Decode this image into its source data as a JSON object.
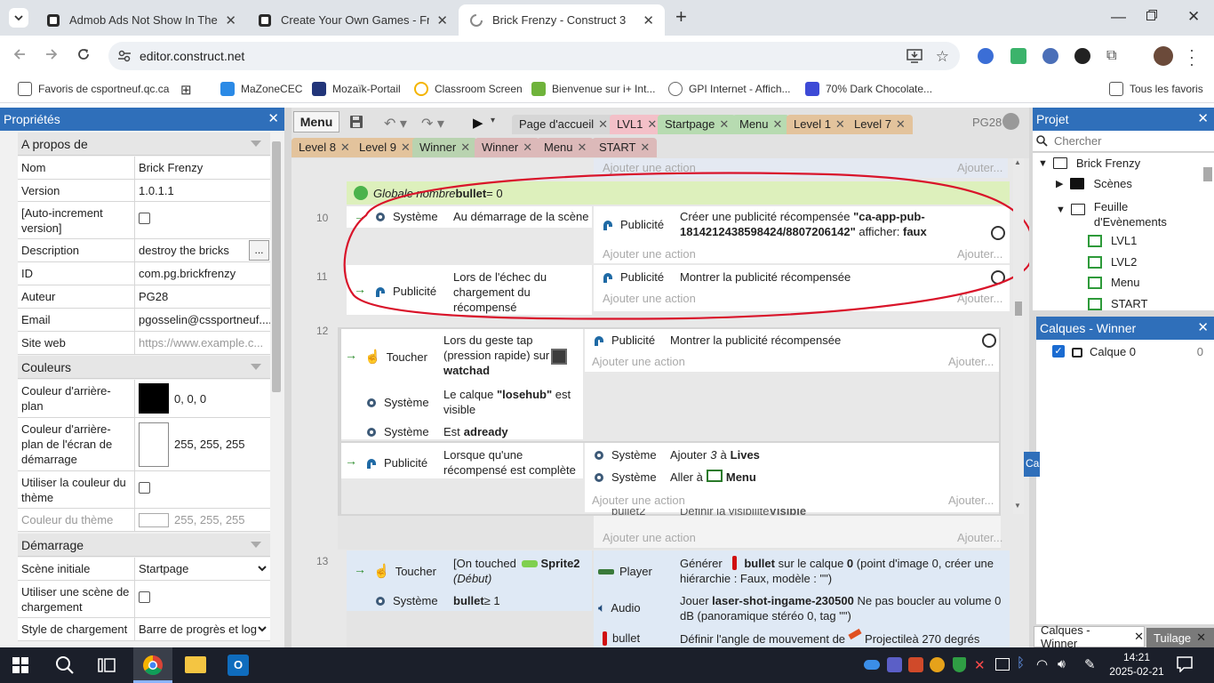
{
  "browser": {
    "tabs": [
      {
        "title": "Admob Ads Not Show In The G",
        "close": "✕"
      },
      {
        "title": "Create Your Own Games - Free",
        "close": "✕"
      },
      {
        "title": "Brick Frenzy - Construct 3",
        "close": "✕"
      }
    ],
    "new_tab": "+",
    "url": "editor.construct.net",
    "bookmarks": [
      "Favoris de csportneuf.qc.ca",
      "MaZoneCEC",
      "Mozaïk-Portail",
      "Classroom Screen",
      "Bienvenue sur i+ Int...",
      "GPI Internet - Affich...",
      "70% Dark Chocolate...",
      "Tous les favoris"
    ]
  },
  "properties": {
    "title": "Propriétés",
    "sections": [
      "A propos de",
      "Couleurs",
      "Démarrage"
    ],
    "rows": [
      {
        "k": "Nom",
        "v": "Brick Frenzy"
      },
      {
        "k": "Version",
        "v": "1.0.1.1"
      },
      {
        "k": "[Auto-increment version]",
        "v": ""
      },
      {
        "k": "Description",
        "v": "destroy the bricks"
      },
      {
        "k": "ID",
        "v": "com.pg.brickfrenzy"
      },
      {
        "k": "Auteur",
        "v": "PG28"
      },
      {
        "k": "Email",
        "v": "pgosselin@cssportneuf...."
      },
      {
        "k": "Site web",
        "v": "https://www.example.c..."
      },
      {
        "k": "Couleur d'arrière-plan",
        "v": "0, 0, 0"
      },
      {
        "k": "Couleur d'arrière-plan de l'écran de démarrage",
        "v": "255, 255, 255"
      },
      {
        "k": "Utiliser la couleur du thème",
        "v": ""
      },
      {
        "k": "Couleur du thème",
        "v": "255, 255, 255"
      },
      {
        "k": "Scène initiale",
        "v": "Startpage"
      },
      {
        "k": "Utiliser une scène de chargement",
        "v": ""
      },
      {
        "k": "Style de chargement",
        "v": "Barre de progrès et log"
      }
    ],
    "desc_btn": "..."
  },
  "editor": {
    "menu": "Menu",
    "tabs_row1": [
      "Page d'accueil",
      "LVL1",
      "Startpage",
      "Menu",
      "Level 1",
      "Level 7"
    ],
    "tabs_row2": [
      "Level 8",
      "Level 9",
      "Winner",
      "Winner",
      "Menu",
      "START"
    ],
    "user": "PG28",
    "add_action": "Ajouter une action",
    "add_short": "Ajouter...",
    "global_var": {
      "prefix": "Globale nombre ",
      "name": "bullet",
      "suffix": " = 0"
    },
    "rows": [
      "10",
      "11",
      "12",
      "13"
    ],
    "e10": {
      "obj": "Système",
      "cond": "Au démarrage de la scène",
      "aobj": "Publicité",
      "act_a": "Créer une publicité récompensée ",
      "act_b": "\"ca-app-pub-1814212438598424/8807206142\"",
      "act_c": " afficher: ",
      "act_d": "faux"
    },
    "e11": {
      "obj": "Publicité",
      "cond": "Lors de l'échec du chargement du récompensé",
      "aobj": "Publicité",
      "act": "Montrer la publicité récompensée"
    },
    "e12": {
      "c1obj": "Toucher",
      "c1a": "Lors du geste tap (pression rapide) sur ",
      "c1b": "watchad",
      "c2obj": "Système",
      "c2a": "Le calque ",
      "c2b": "\"losehub\"",
      "c2c": " est visible",
      "c3obj": "Système",
      "c3a": "Est ",
      "c3b": "adready",
      "aobj": "Publicité",
      "act": "Montrer la publicité récompensée",
      "s1obj": "Publicité",
      "s1cond": "Lorsque qu'une récompensé est complète",
      "s1a1obj": "Système",
      "s1a1a": "Ajouter ",
      "s1a1b": "3",
      "s1a1c": " à ",
      "s1a1d": "Lives",
      "s1a2obj": "Système",
      "s1a2a": "Aller à ",
      "s1a2b": "Menu",
      "partial_obj": "bullet2",
      "partial_a": "Définir la visibilité ",
      "partial_b": "Visible"
    },
    "e13": {
      "c1obj": "Toucher",
      "c1a": "[On touched ",
      "c1b": "Sprite2",
      "c1c": " (Début)",
      "c2obj": "Système",
      "c2a": "bullet",
      "c2b": " ≥ 1",
      "a1obj": "Player",
      "a1a": "Générer ",
      "a1b": "bullet",
      "a1c": " sur le calque ",
      "a1d": "0",
      "a1e": " (point d'image 0, créer une hiérarchie : Faux, modèle : \"\")",
      "a2obj": "Audio",
      "a2a": "Jouer ",
      "a2b": "laser-shot-ingame-230500",
      "a2c": " Ne pas boucler au volume 0 dB (panoramique stéréo 0, tag \"\")",
      "a3obj": "bullet",
      "a3a": "Définir l'angle de mouvement de ",
      "a3b": "Projectile",
      "a3c": " à 270 degrés"
    }
  },
  "project": {
    "title": "Projet",
    "search": "Chercher",
    "tree": [
      "Brick Frenzy",
      "Scènes",
      "Feuille d'Evènements",
      "LVL1",
      "LVL2",
      "Menu",
      "START"
    ]
  },
  "layers": {
    "title": "Calques - Winner",
    "layer": "Calque 0",
    "count": "0",
    "peek": "Ca"
  },
  "bottom_tabs": [
    "Calques - Winner",
    "Tuilage"
  ],
  "taskbar": {
    "time": "14:21",
    "date": "2025-02-21"
  }
}
